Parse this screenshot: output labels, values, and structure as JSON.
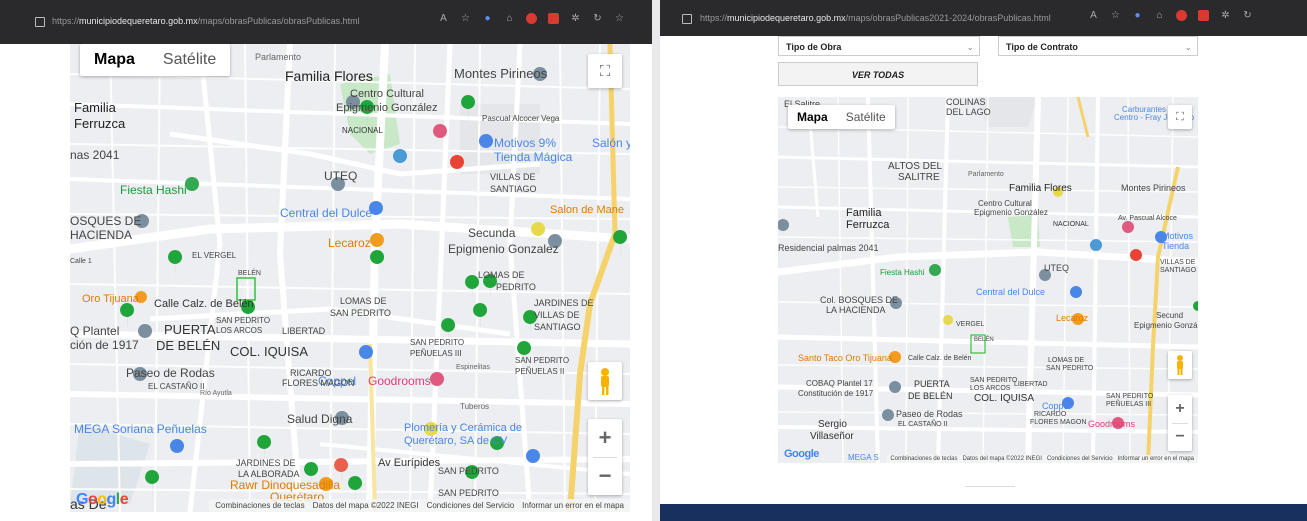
{
  "left": {
    "url_prefix": "https://",
    "url_host": "municipiodequeretaro.gob.mx",
    "url_path": "/maps/obrasPublicas/obrasPublicas.html",
    "map_type": [
      "Mapa",
      "Satélite"
    ],
    "fullscreen_icon": "fullscreen-icon",
    "zoom_in": "+",
    "zoom_out": "−",
    "google": [
      "G",
      "o",
      "o",
      "g",
      "l",
      "e"
    ],
    "footer": [
      "Combinaciones de teclas",
      "Datos del mapa ©2022 INEGI",
      "Condiciones del Servicio",
      "Informar un error en el mapa"
    ],
    "labels": [
      "Parlamento",
      "Familia Flores",
      "Montes Pirineos",
      "Familia",
      "Ferruzca",
      "Centro Cultural",
      "Epigmenio González",
      "NACIONAL",
      "Pascual Alcocer Vega",
      "Motivos 9%",
      "Tienda Mágica",
      "Salón y",
      "nas 2041",
      "UTEQ",
      "VILLAS DE",
      "SANTIAGO",
      "Fiesta Hashi",
      "Central del Dulce",
      "Salon de Mane",
      "OSQUES DE",
      "HACIENDA",
      "Lecaroz",
      "Secunda",
      "Epigmenio Gonzalez",
      "EL VERGEL",
      "BELÉN",
      "Calle 1",
      "LOMAS DE",
      "PEDRITO",
      "Oro Tijuana",
      "Calle Calz. de Belén",
      "LOMAS DE",
      "SAN PEDRITO",
      "JARDINES DE",
      "VILLAS DE",
      "SANTIAGO",
      "Q Plantel",
      "ción de 1917",
      "PUERTA",
      "DE BELÉN",
      "SAN PEDRITO",
      "LOS ARCOS",
      "LIBERTAD",
      "COL. IQUISA",
      "SAN PEDRITO",
      "PEÑUELAS III",
      "SAN PEDRITO",
      "PEÑUELAS II",
      "Coppel",
      "Paseo de Rodas",
      "EL CASTAÑO II",
      "RICARDO",
      "FLORES MAGON",
      "Goodrooms",
      "Salud Digna",
      "MEGA Soriana Peñuelas",
      "Plomería y Cerámica de",
      "Querétaro, SA de CV",
      "JARDINES DE",
      "LA ALBORADA",
      "Av Eurípides",
      "Rawr Dinoquesadilla",
      "Querétaro",
      "SAN PEDRITO",
      "SAN PEDRITO",
      "Río Ayutla",
      "Tuberos",
      "Espinelitas",
      "as De"
    ]
  },
  "right": {
    "url_prefix": "https://",
    "url_host": "municipiodequeretaro.gob.mx",
    "url_path": "/maps/obrasPublicas2021-2024/obrasPublicas.html",
    "select_obra": "Tipo de Obra",
    "select_contrato": "Tipo de Contrato",
    "ver_todas": "VER TODAS",
    "map_type": [
      "Mapa",
      "Satélite"
    ],
    "zoom_in": "+",
    "zoom_out": "−",
    "google": "Google",
    "footer": [
      "Combinaciones de teclas",
      "Datos del mapa ©2022 INEGI",
      "Condiciones del Servicio",
      "Informar un error en el mapa"
    ],
    "labels": [
      "El Salitre",
      "COLINAS",
      "DEL LAGO",
      "Carburantes del",
      "Centro - Fray Junipero",
      "ALTOS DEL",
      "SALITRE",
      "Parlamento",
      "Familia Flores",
      "Montes Pirineos",
      "Centro Cultural",
      "Epigmenio González",
      "Familia",
      "Ferruzca",
      "NACIONAL",
      "Av. Pascual Alcoce",
      "Motivos",
      "Tienda",
      "Residencial palmas 2041",
      "UTEQ",
      "VILLAS DE",
      "SANTIAGO",
      "Fiesta Hashi",
      "Central del Dulce",
      "Col. BOSQUES DE",
      "LA HACIENDA",
      "Lecaroz",
      "Secund",
      "Epigmenio Gonzál",
      "VERGEL",
      "BELÉN",
      "Santo Taco Oro Tijuana",
      "Calle Calz. de Belén",
      "LOMAS DE",
      "SAN PEDRITO",
      "COBAQ Plantel 17",
      "Constitución de 1917",
      "PUERTA",
      "DE BELÉN",
      "SAN PEDRITO",
      "LOS ARCOS",
      "LIBERTAD",
      "COL. IQUISA",
      "SAN PEDRITO",
      "PEÑUELAS III",
      "Coppel",
      "Paseo de Rodas",
      "EL CASTAÑO II",
      "RICARDO",
      "FLORES MAGON",
      "Goodrooms",
      "Sergio",
      "Villaseñor",
      "MEGA S"
    ]
  }
}
